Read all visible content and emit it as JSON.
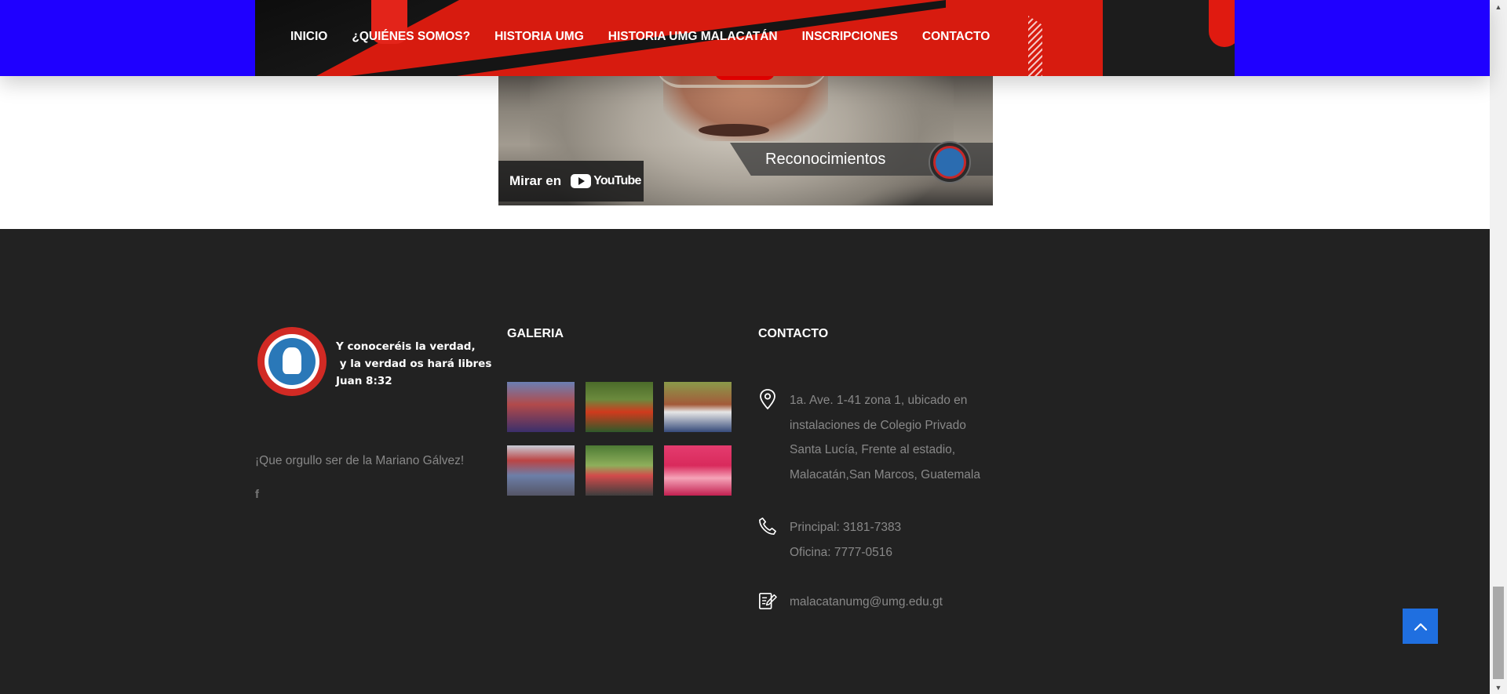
{
  "nav": {
    "items": [
      "INICIO",
      "¿QUIÉNES SOMOS?",
      "HISTORIA UMG",
      "HISTORIA UMG MALACATÁN",
      "INSCRIPCIONES",
      "CONTACTO"
    ]
  },
  "video": {
    "overlay_title": "Reconocimientos",
    "watch_label": "Mirar en",
    "youtube_word": "YouTube"
  },
  "footer": {
    "brand": {
      "motto_lines": [
        "Y conoceréis la verdad,",
        " y la verdad os hará libres",
        "Juan 8:32"
      ]
    },
    "pride_text": "¡Que orgullo ser de la Mariano Gálvez!",
    "facebook_icon": "f",
    "gallery_title": "GALERIA",
    "contact_title": "CONTACTO",
    "contact": {
      "address_lines": [
        "1a. Ave. 1-41 zona 1, ubicado en",
        "instalaciones de Colegio Privado",
        "Santa Lucía, Frente al estadio,",
        "Malacatán,San Marcos, Guatemala"
      ],
      "phone_lines": [
        "Principal: 3181-7383",
        "Oficina: 7777-0516"
      ],
      "email": "malacatanumg@umg.edu.gt"
    }
  },
  "colors": {
    "header_blue": "#1f00ff",
    "nav_red": "#d71b0f",
    "footer_bg": "#222222",
    "back_to_top": "#1f6fe0"
  },
  "icons": {
    "location": "map-pin-icon",
    "phone": "phone-icon",
    "email": "edit-document-icon",
    "back_to_top": "chevron-up-icon"
  }
}
